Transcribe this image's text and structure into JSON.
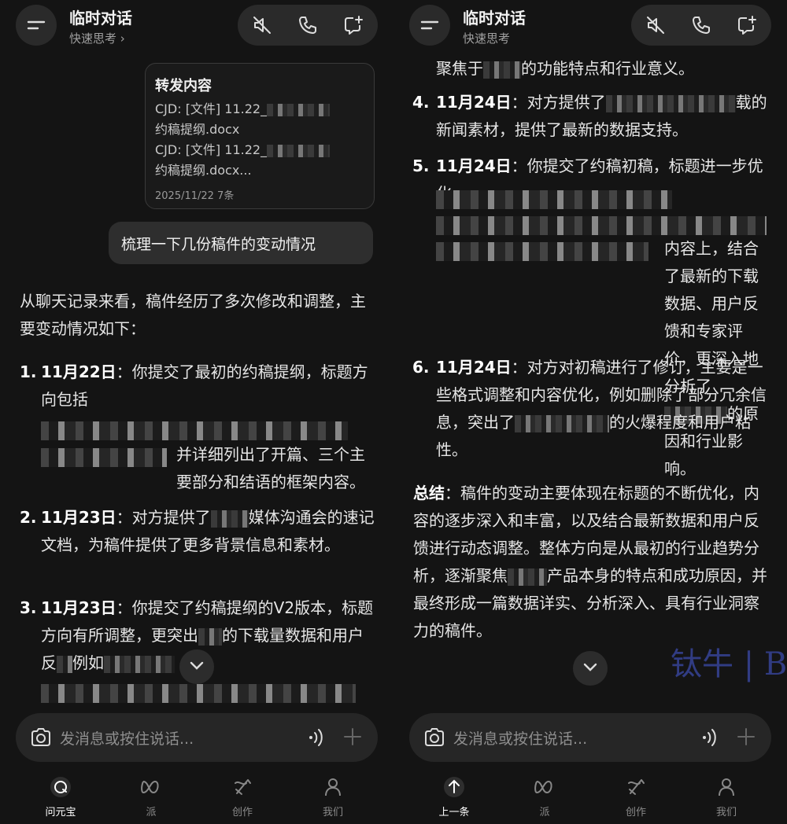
{
  "left": {
    "header": {
      "title": "临时对话",
      "subtitle": "快速思考 ›"
    },
    "forward_card": {
      "title": "转发内容",
      "lines": [
        "CJD: [文件] 11.22_",
        "约稿提纲.docx",
        "CJD: [文件] 11.22_",
        "约稿提纲.docx..."
      ],
      "meta": "2025/11/22  7条"
    },
    "user_message": "梳理一下几份稿件的变动情况",
    "intro": "从聊天记录来看，稿件经历了多次修改和调整，主要变动情况如下：",
    "items": [
      {
        "num": "1.",
        "date": "11月22日",
        "text_a": "：你提交了最初的约稿提纲，标题方向包括",
        "text_b": "并详细列出了开篇、三个主要部分和结语的框架内容。"
      },
      {
        "num": "2.",
        "date": "11月23日",
        "text_a": "：对方提供了",
        "text_b": "媒体沟通会的速记文档，为稿件提供了更多背景信息和素材。"
      },
      {
        "num": "3.",
        "date": "11月23日",
        "text_a": "：你提交了约稿提纲的V2版本，标题方向有所调整，更突出",
        "text_b": "的下载量数据和用户反",
        "text_c": "例如"
      }
    ]
  },
  "right": {
    "header": {
      "title": "临时对话",
      "subtitle": "快速思考"
    },
    "top_text": "聚焦于",
    "top_text_b": "的功能特点和行业意义。",
    "items": [
      {
        "num": "4.",
        "date": "11月24日",
        "text_a": "：对方提供了",
        "text_b": "载的新闻素材，提供了最新的数据支持。"
      },
      {
        "num": "5.",
        "date": "11月24日",
        "text_a": "：你提交了约稿初稿，标题进一步优化",
        "text_b": "内容上，结合了最新的下载数据、用户反馈和专家评价，更深入地分析了",
        "text_c": "的原因和行业影响。"
      },
      {
        "num": "6.",
        "date": "11月24日",
        "text_a": "：对方对初稿进行了修订，主要是一些格式调整和内容优化，例如删除了部分冗余信息，突出了",
        "text_b": "的火爆程度和用户粘性。"
      }
    ],
    "summary_label": "总结",
    "summary": "：稿件的变动主要体现在标题的不断优化，内容的逐步深入和丰富，以及结合最新数据和用户反馈进行动态调整。整体方向是从最初的行业趋势分析，逐渐聚焦",
    "summary_b": "产品本身的特点和成功原因，并最终形成一篇数据详实、分析深入、具有行业洞察力的稿件。",
    "watermark": "钛牛 | BiaNews"
  },
  "input": {
    "placeholder": "发消息或按住说话..."
  },
  "tabs_left": [
    {
      "label": "问元宝",
      "icon": "yuanbao-icon"
    },
    {
      "label": "派",
      "icon": "pai-icon"
    },
    {
      "label": "创作",
      "icon": "create-icon"
    },
    {
      "label": "我们",
      "icon": "profile-icon"
    }
  ],
  "tabs_right": [
    {
      "label": "上一条",
      "icon": "arrow-up-icon"
    },
    {
      "label": "派",
      "icon": "pai-icon"
    },
    {
      "label": "创作",
      "icon": "create-icon"
    },
    {
      "label": "我们",
      "icon": "profile-icon"
    }
  ],
  "colors": {
    "background": "#141414",
    "bubble": "#2e2e2e",
    "accent": "#ffffff"
  }
}
